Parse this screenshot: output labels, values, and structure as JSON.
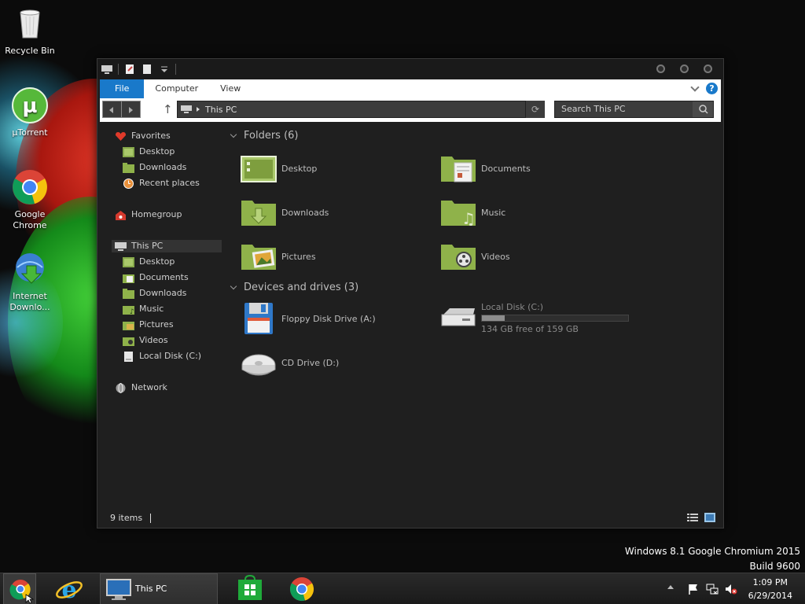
{
  "desktop": {
    "icons": [
      {
        "label": "Recycle Bin"
      },
      {
        "label": "µTorrent"
      },
      {
        "label": "Google Chrome"
      },
      {
        "label": "Internet Downlo..."
      }
    ]
  },
  "window": {
    "tabs": {
      "file": "File",
      "computer": "Computer",
      "view": "View"
    },
    "help_label": "?",
    "address": "This PC",
    "search_placeholder": "Search This PC",
    "nav": {
      "favorites": "Favorites",
      "fav_desktop": "Desktop",
      "fav_downloads": "Downloads",
      "fav_recent": "Recent places",
      "homegroup": "Homegroup",
      "this_pc": "This PC",
      "pc_desktop": "Desktop",
      "pc_documents": "Documents",
      "pc_downloads": "Downloads",
      "pc_music": "Music",
      "pc_pictures": "Pictures",
      "pc_videos": "Videos",
      "pc_localdisk": "Local Disk (C:)",
      "network": "Network"
    },
    "folders_header": "Folders (6)",
    "folders": {
      "desktop": "Desktop",
      "documents": "Documents",
      "downloads": "Downloads",
      "music": "Music",
      "pictures": "Pictures",
      "videos": "Videos"
    },
    "devices_header": "Devices and drives (3)",
    "devices": {
      "floppy": "Floppy Disk Drive (A:)",
      "local_disk": "Local Disk (C:)",
      "local_disk_free": "134 GB free of 159 GB",
      "local_disk_used_fraction": 0.157,
      "cd": "CD Drive (D:)"
    },
    "status": "9 items"
  },
  "watermark": {
    "line1": "Windows 8.1 Google Chromium 2015",
    "line2": "Build 9600"
  },
  "taskbar": {
    "explorer_label": "This PC",
    "time": "1:09 PM",
    "date": "6/29/2014"
  },
  "colors": {
    "accent": "#1979ca",
    "folder_green": "#8fb24a"
  }
}
